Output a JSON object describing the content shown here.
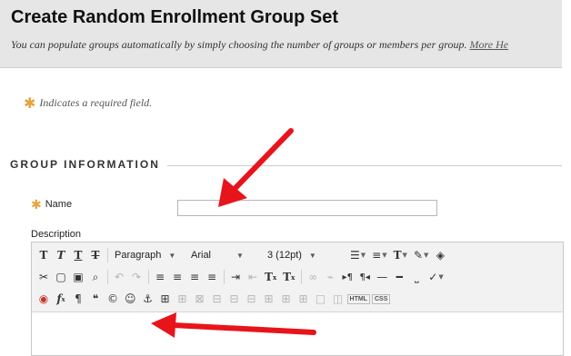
{
  "header": {
    "title": "Create Random Enrollment Group Set",
    "subtitle": "You can populate groups automatically by simply choosing the number of groups or members per group.",
    "more_link": "More He"
  },
  "required_note": "Indicates a required field.",
  "section_title": "GROUP INFORMATION",
  "form": {
    "name_label": "Name",
    "name_value": "",
    "description_label": "Description"
  },
  "toolbar": {
    "format_select": "Paragraph",
    "font_select": "Arial",
    "size_select": "3 (12pt)",
    "html_label": "HTML",
    "css_label": "CSS"
  },
  "icons": {
    "row1": [
      "bold-icon",
      "italic-icon",
      "underline-icon",
      "strikethrough-icon"
    ],
    "annotation": "red-arrow-icon"
  },
  "colors": {
    "required_star": "#e8a33d",
    "arrow": "#e8141b",
    "header_bg": "#e6e6e6"
  }
}
